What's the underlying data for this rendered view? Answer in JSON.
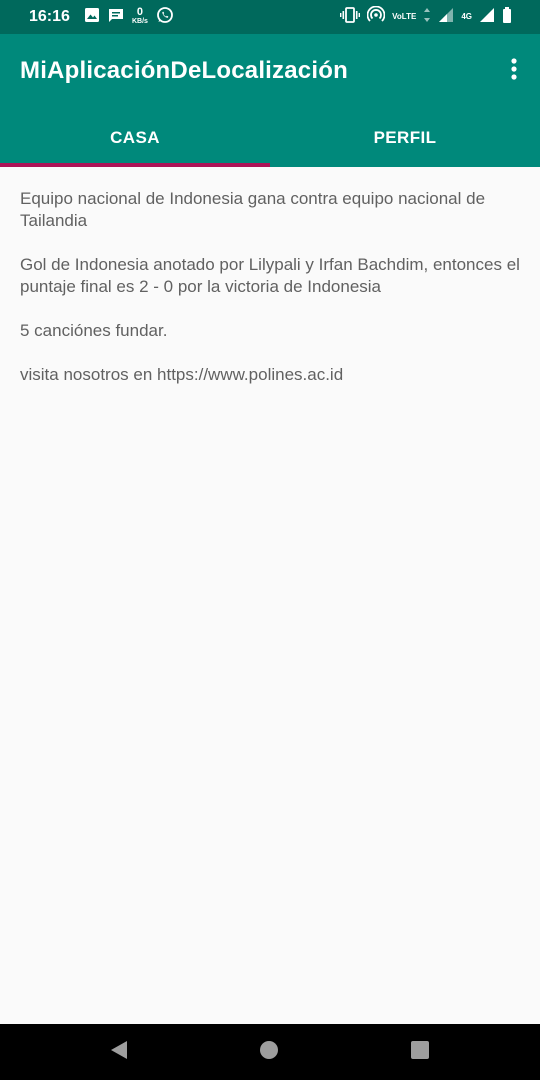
{
  "status_bar": {
    "time": "16:16",
    "data_speed_value": "0",
    "data_speed_unit": "KB/s",
    "volte_label": "VoLTE",
    "network_label": "4G",
    "icons": [
      "image-icon",
      "message-icon",
      "whatsapp-icon",
      "vibrate-icon",
      "hotspot-icon",
      "volte-icon",
      "signal-icon",
      "battery-icon"
    ]
  },
  "app_bar": {
    "title": "MiAplicaciónDeLocalización",
    "overflow_icon": "more-vert-icon"
  },
  "tabs": [
    {
      "label": "CASA",
      "selected": true
    },
    {
      "label": "PERFIL",
      "selected": false
    }
  ],
  "colors": {
    "status_bar": "#00695c",
    "app_bar": "#00897b",
    "tab_indicator": "#ad1457",
    "body_text": "#616161",
    "background": "#fafafa"
  },
  "content": {
    "paragraphs": [
      "Equipo nacional de Indonesia gana contra equipo nacional de Tailandia",
      "Gol de Indonesia anotado por Lilypali y Irfan Bachdim, entonces el puntaje final es 2 - 0 por la victoria de Indonesia",
      "5 canciónes fundar.",
      "visita nosotros en https://www.polines.ac.id"
    ]
  },
  "nav_bar": {
    "icons": [
      "back-icon",
      "home-icon",
      "recents-icon"
    ]
  }
}
